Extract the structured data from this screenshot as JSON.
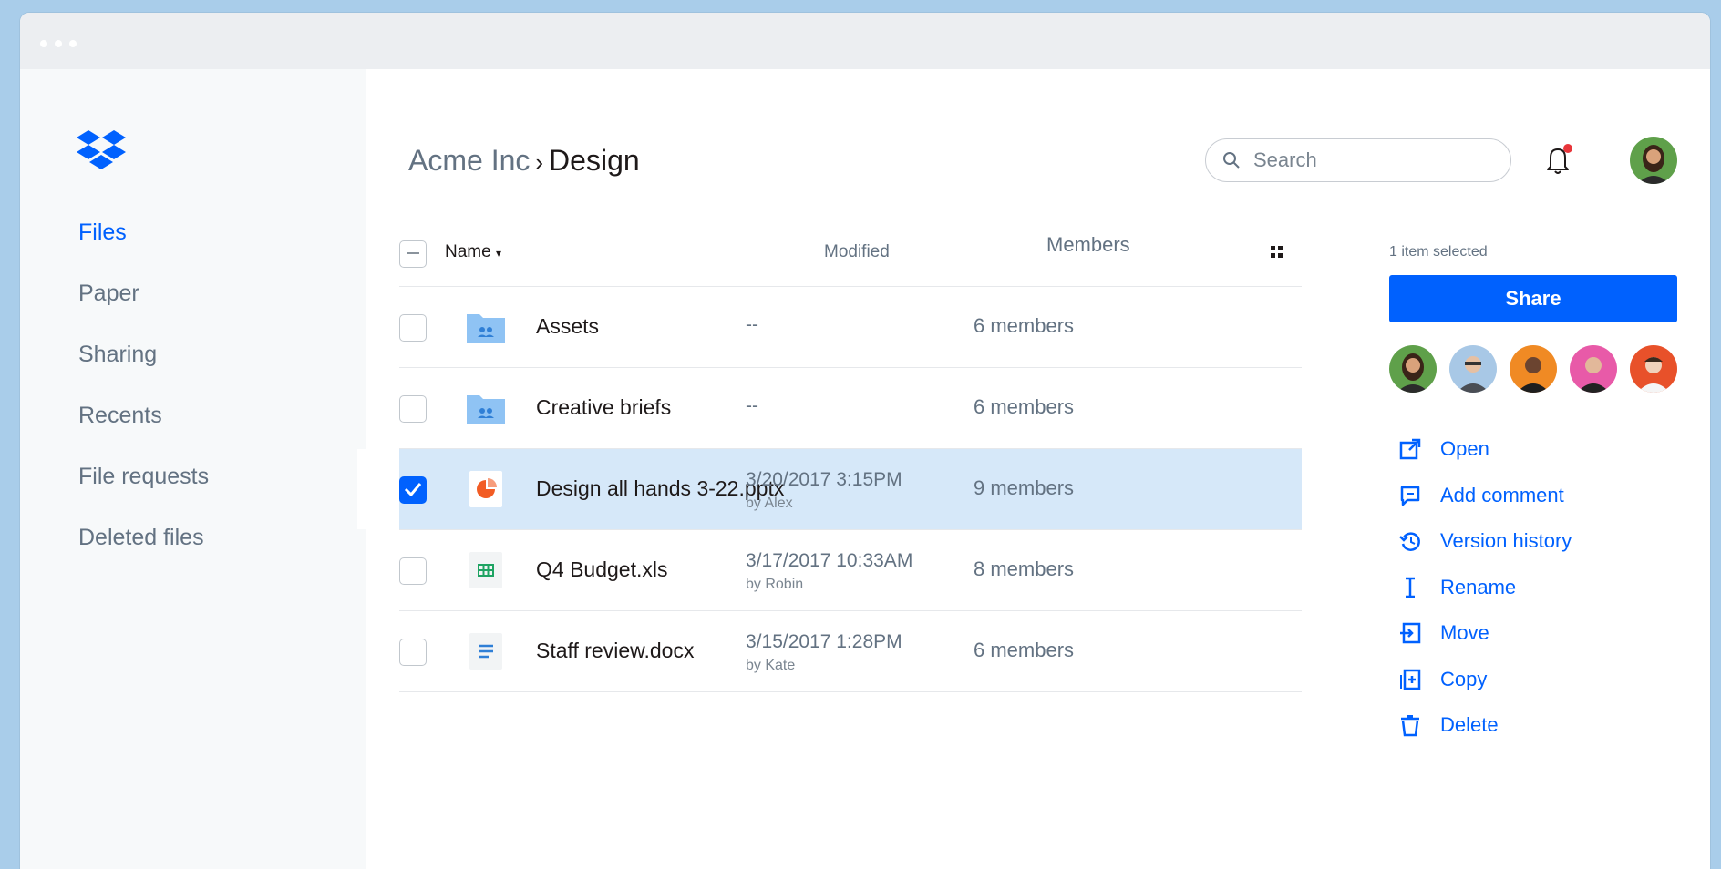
{
  "colors": {
    "accent": "#0061fe",
    "selected_row": "#d6e8f9",
    "sidebar_bg": "#f7f9fa",
    "text_muted": "#637282",
    "notification_dot": "#e8353a",
    "pptx_icon": "#f25c24",
    "xls_icon": "#1ea362"
  },
  "sidebar": {
    "logo": "dropbox-logo",
    "items": [
      {
        "label": "Files",
        "active": true
      },
      {
        "label": "Paper",
        "active": false
      },
      {
        "label": "Sharing",
        "active": false
      },
      {
        "label": "Recents",
        "active": false
      },
      {
        "label": "File requests",
        "active": false
      },
      {
        "label": "Deleted files",
        "active": false
      }
    ]
  },
  "header": {
    "breadcrumb_parent": "Acme Inc",
    "breadcrumb_separator": "›",
    "breadcrumb_current": "Design",
    "search_placeholder": "Search",
    "notification_icon": "bell-icon",
    "has_notification": true
  },
  "table": {
    "columns": {
      "name": "Name",
      "modified": "Modified",
      "members": "Members"
    },
    "rows": [
      {
        "icon": "shared-folder-icon",
        "name": "Assets",
        "modified": "--",
        "by": "",
        "members": "6 members",
        "checked": false
      },
      {
        "icon": "shared-folder-icon",
        "name": "Creative briefs",
        "modified": "--",
        "by": "",
        "members": "6 members",
        "checked": false
      },
      {
        "icon": "pptx-icon",
        "name": "Design all hands 3-22.pptx",
        "modified": "3/20/2017 3:15PM",
        "by": "by Alex",
        "members": "9 members",
        "checked": true
      },
      {
        "icon": "xls-icon",
        "name": "Q4 Budget.xls",
        "modified": "3/17/2017 10:33AM",
        "by": "by Robin",
        "members": "8 members",
        "checked": false
      },
      {
        "icon": "docx-icon",
        "name": "Staff review.docx",
        "modified": "3/15/2017 1:28PM",
        "by": "by Kate",
        "members": "6 members",
        "checked": false
      }
    ]
  },
  "panel": {
    "selected_count": "1 item selected",
    "share_label": "Share",
    "actions": [
      {
        "label": "Open",
        "icon": "open-icon"
      },
      {
        "label": "Add comment",
        "icon": "comment-icon"
      },
      {
        "label": "Version history",
        "icon": "history-icon"
      },
      {
        "label": "Rename",
        "icon": "rename-icon"
      },
      {
        "label": "Move",
        "icon": "move-icon"
      },
      {
        "label": "Copy",
        "icon": "copy-icon"
      },
      {
        "label": "Delete",
        "icon": "trash-icon"
      }
    ]
  }
}
